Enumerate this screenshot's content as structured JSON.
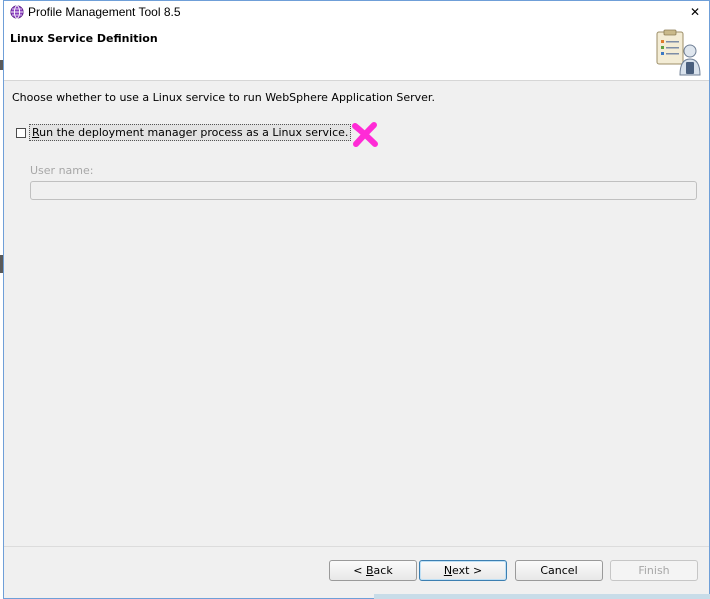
{
  "window": {
    "title": "Profile Management Tool 8.5",
    "close_glyph": "✕",
    "title_icon": "globe-icon"
  },
  "header": {
    "title": "Linux Service Definition",
    "icon": "wizard-clipboard-user-icon"
  },
  "main": {
    "description": "Choose whether to use a Linux service to run WebSphere Application Server.",
    "checkbox": {
      "mnemonic": "R",
      "label_rest": "un the deployment manager process as a Linux service.",
      "checked": false
    },
    "annotation_mark": "magenta-x-icon",
    "username": {
      "label": "User name:",
      "value": ""
    }
  },
  "buttons": {
    "back_prefix": "< ",
    "back_mnemonic": "B",
    "back_rest": "ack",
    "next_mnemonic": "N",
    "next_rest": "ext >",
    "cancel": "Cancel",
    "finish": "Finish"
  },
  "colors": {
    "accent": "#3c7fb1",
    "annotation": "#ff2bd6",
    "disabled_text": "#a7a7a7"
  }
}
